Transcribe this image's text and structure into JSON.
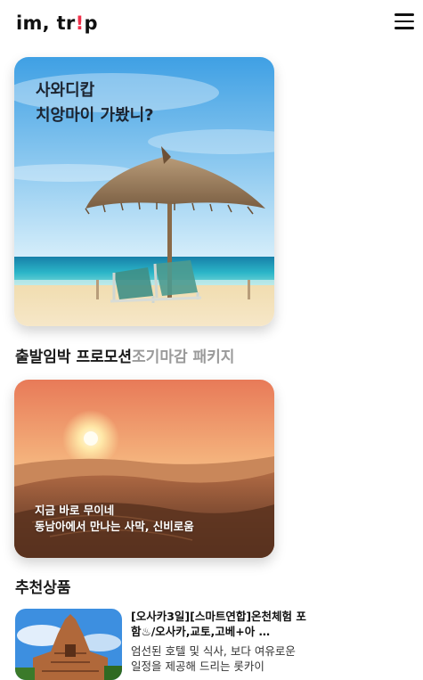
{
  "header": {
    "logo_prefix": "im, tr",
    "logo_accent": "!",
    "logo_suffix": "p",
    "menu_icon": "hamburger-menu-icon"
  },
  "hero": {
    "line1": "사와디캅",
    "line2": "치앙마이 가봤니?"
  },
  "tabs": {
    "active": "출발임박 프로모션",
    "inactive": "조기마감 패키지"
  },
  "promo": {
    "line1": "지금 바로 무이네",
    "line2": "동남아에서 만나는 사막, 신비로움"
  },
  "recommended": {
    "title": "추천상품",
    "item": {
      "title": "[오사카3일][스마트연합]온천체험 포함♨/오사카,교토,고베+아 …",
      "desc": "엄선된 호텔 및 식사, 보다 여유로운 일정을 제공해 드리는 롯카이"
    }
  },
  "colors": {
    "accent": "#f0304a",
    "text": "#111111",
    "muted": "#9a9a9a"
  }
}
